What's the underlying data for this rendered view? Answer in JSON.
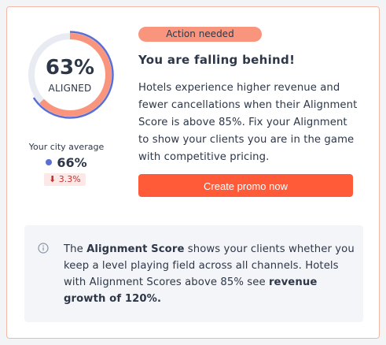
{
  "score": {
    "percent_text": "63%",
    "percent": 63,
    "label": "ALIGNED",
    "city_percent": 66
  },
  "city": {
    "label": "Your city average",
    "value": "66%",
    "delta": "⬇ 3.3%"
  },
  "alert": {
    "badge": "Action needed",
    "headline": "You are falling behind!",
    "body": "Hotels experience higher revenue and fewer cancellations when their Alignment Score is above 85%. Fix your Alignment to show your clients you are in the game with competitive pricing.",
    "button": "Create promo now"
  },
  "info": {
    "icon": "info-icon",
    "part1": "The ",
    "bold1": "Alignment Score",
    "part2": " shows your clients whether you keep a level playing field across all channels. Hotels with Alignment Scores above 85% see ",
    "bold2": "revenue growth of 120%."
  },
  "colors": {
    "accent": "#ff5b39",
    "badge": "#f9957c",
    "ring_score": "#f9957c",
    "ring_city": "#5b6ed6",
    "ring_track": "#e8ebf2",
    "delta_bg": "#fde8e8",
    "delta_text": "#c53030"
  }
}
